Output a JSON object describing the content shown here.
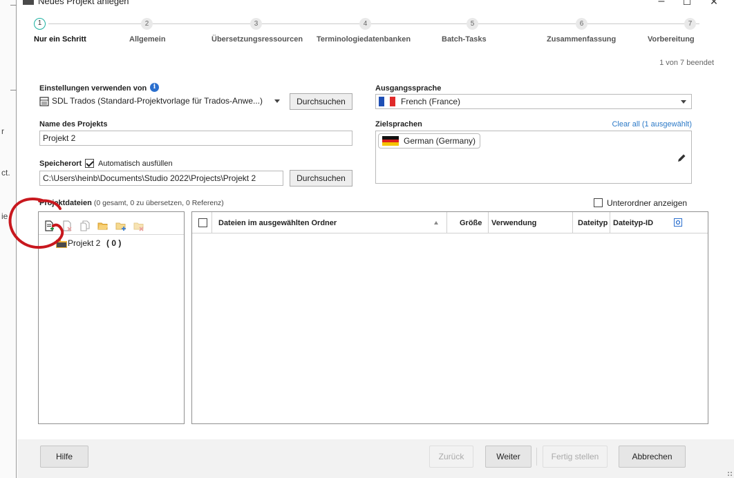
{
  "window": {
    "title": "Neues Projekt anlegen",
    "minimize_glyph": "–",
    "maximize_glyph": "☐",
    "close_glyph": "✕"
  },
  "background_fragments": [
    "r",
    "ct.",
    "ie"
  ],
  "steps": [
    {
      "number": "1",
      "label": "Nur ein Schritt",
      "active": true
    },
    {
      "number": "2",
      "label": "Allgemein"
    },
    {
      "number": "3",
      "label": "Übersetzungsressourcen"
    },
    {
      "number": "4",
      "label": "Terminologiedatenbanken"
    },
    {
      "number": "5",
      "label": "Batch-Tasks"
    },
    {
      "number": "6",
      "label": "Zusammenfassung"
    },
    {
      "number": "7",
      "label": "Vorbereitung"
    }
  ],
  "progress_text": "1 von 7 beendet",
  "settings": {
    "label": "Einstellungen verwenden von",
    "template_value": "SDL Trados (Standard-Projektvorlage für Trados-Anwe...)",
    "browse_label": "Durchsuchen"
  },
  "project_name": {
    "label": "Name des Projekts",
    "value": "Projekt 2"
  },
  "location": {
    "label": "Speicherort",
    "auto_fill_label": "Automatisch ausfüllen",
    "auto_fill_checked": true,
    "value": "C:\\Users\\heinb\\Documents\\Studio 2022\\Projects\\Projekt 2",
    "browse_label": "Durchsuchen"
  },
  "source_language": {
    "label": "Ausgangssprache",
    "value": "French (France)"
  },
  "target_languages": {
    "label": "Zielsprachen",
    "clear_link": "Clear all (1 ausgewählt)",
    "items": [
      "German (Germany)"
    ]
  },
  "project_files": {
    "label": "Projektdateien",
    "summary": "(0 gesamt, 0 zu übersetzen, 0 Referenz)",
    "show_subfolders_label": "Unterordner anzeigen",
    "tree_root": "Projekt 2",
    "tree_count": "( 0 )",
    "toolbar_icons": [
      "add-file-icon",
      "remove-file-icon",
      "copy-file-icon",
      "open-folder-icon",
      "add-folder-icon",
      "remove-folder-icon"
    ],
    "columns": [
      "Dateien im ausgewählten Ordner",
      "Größe",
      "Verwendung",
      "Dateityp",
      "Dateityp-ID"
    ]
  },
  "footer": {
    "help": "Hilfe",
    "back": "Zurück",
    "next": "Weiter",
    "finish": "Fertig stellen",
    "cancel": "Abbrechen"
  },
  "colors": {
    "accent_step": "#1ab0a0",
    "link": "#2b79c7",
    "annotation": "#c8181e"
  }
}
